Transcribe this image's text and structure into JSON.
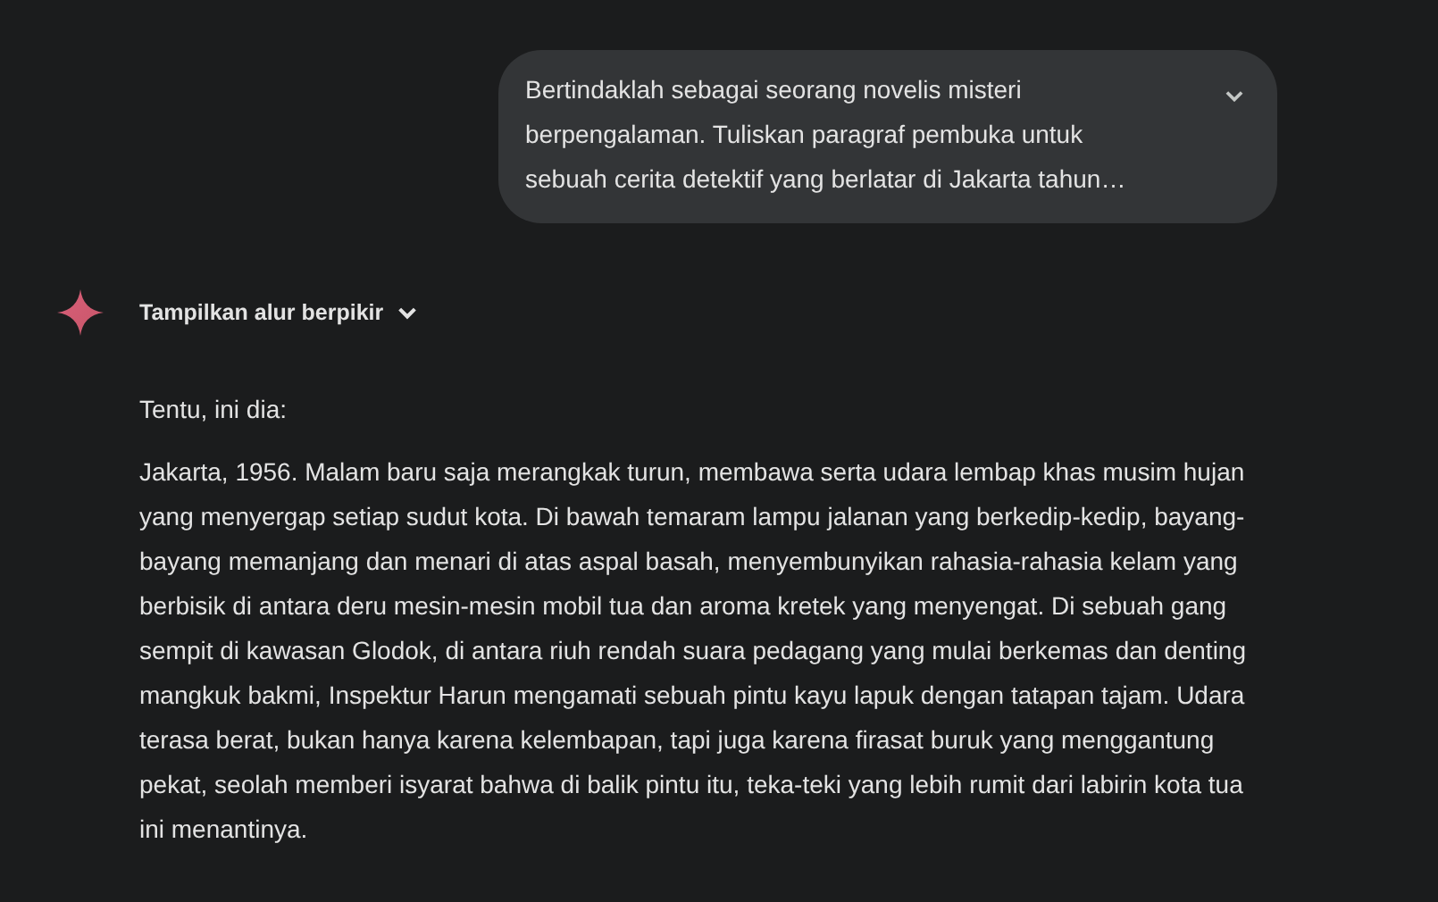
{
  "user_prompt": {
    "text": "Bertindaklah sebagai seorang novelis misteri berpengalaman. Tuliskan paragraf pembuka untuk sebuah cerita detektif yang berlatar di Jakarta tahun…",
    "expanded": false
  },
  "response": {
    "thinking_toggle": {
      "label": "Tampilkan alur berpikir",
      "expanded": false
    },
    "paragraphs": [
      "Tentu, ini dia:",
      "Jakarta, 1956. Malam baru saja merangkak turun, membawa serta udara lembap khas musim hujan yang menyergap setiap sudut kota. Di bawah temaram lampu jalanan yang berkedip-kedip, bayang-bayang memanjang dan menari di atas aspal basah, menyembunyikan rahasia-rahasia kelam yang berbisik di antara deru mesin-mesin mobil tua dan aroma kretek yang menyengat. Di sebuah gang sempit di kawasan Glodok, di antara riuh rendah suara pedagang yang mulai berkemas dan denting mangkuk bakmi, Inspektur Harun mengamati sebuah pintu kayu lapuk dengan tatapan tajam. Udara terasa berat, bukan hanya karena kelembapan, tapi juga karena firasat buruk yang menggantung pekat, seolah memberi isyarat bahwa di balik pintu itu, teka-teki yang lebih rumit dari labirin kota tua ini menantinya."
    ]
  }
}
